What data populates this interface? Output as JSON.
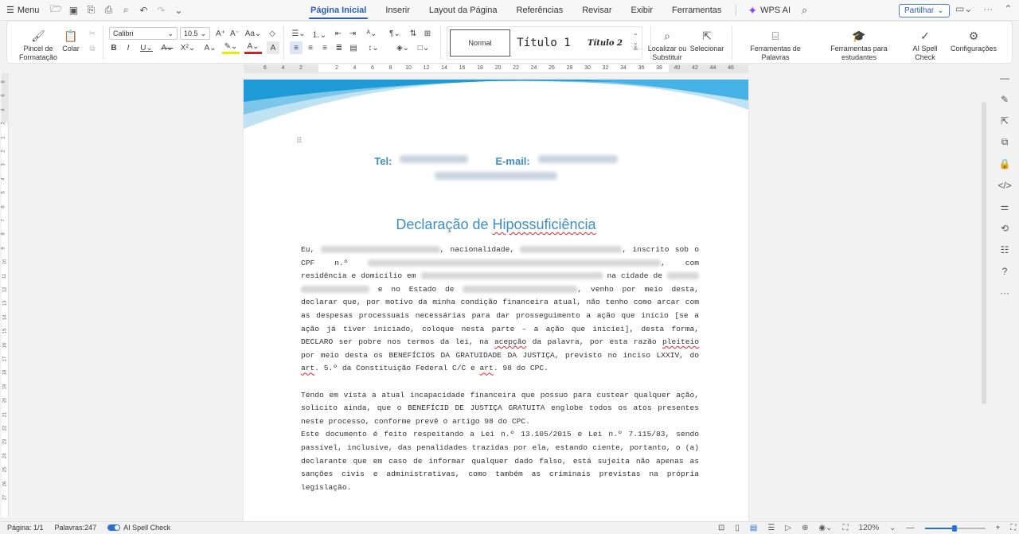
{
  "topbar": {
    "menu_label": "Menu",
    "tabs": [
      "Página Inicial",
      "Inserir",
      "Layout da Página",
      "Referências",
      "Revisar",
      "Exibir",
      "Ferramentas"
    ],
    "wps_ai": "WPS AI",
    "share_label": "Partilhar"
  },
  "ribbon": {
    "format_painter": "Pincel de Formatação",
    "paste": "Colar",
    "font_name": "Calibri",
    "font_size": "10.5",
    "style_normal": "Normal",
    "style_title1": "Título 1",
    "style_title2": "Título 2",
    "find_replace": "Localizar ou Substituir",
    "select": "Selecionar",
    "word_tools": "Ferramentas de Palavras",
    "student_tools": "Ferramentas para estudantes",
    "ai_spell": "AI Spell Check",
    "settings": "Configurações"
  },
  "ruler": {
    "marks": [
      "6",
      "4",
      "2",
      "",
      "2",
      "4",
      "6",
      "8",
      "10",
      "12",
      "14",
      "16",
      "18",
      "20",
      "22",
      "24",
      "26",
      "28",
      "30",
      "32",
      "34",
      "36",
      "38",
      "40",
      "42",
      "44",
      "46"
    ]
  },
  "document": {
    "tel_label": "Tel:",
    "email_label": "E-mail:",
    "title_prefix": "Declaração de ",
    "title_word": "Hipossuficiência",
    "p1": {
      "a": "Eu, ",
      "b": ", nacionalidade, ",
      "c": ", inscrito sob o CPF n.º ",
      "d": ", com residência e domicílio em ",
      "e": " na cidade de ",
      "f": " e no Estado de ",
      "g": ", venho por meio desta, declarar que, por motivo da minha condição financeira atual, não tenho como arcar com as despesas processuais necessárias para dar prosseguimento a ação que início [se a ação já tiver iniciado, coloque nesta parte – a ação que iniciei], desta forma, DECLARO ser pobre nos termos da lei, na ",
      "h": "acepção",
      "i": " da palavra,  por esta razão ",
      "j": "pleiteio",
      "k": " por meio desta os BENEFÍCIOS DA GRATUIDADE DA JUSTIÇA, previsto no inciso LXXIV, do ",
      "l": "art",
      "m": ". 5.º da Constituição Federal C/C e ",
      "n": "art",
      "o": ". 98 do CPC."
    },
    "p2": "Tendo em vista a atual incapacidade financeira que possuo para custear qualquer ação, solicito ainda, que o BENEFÍCID DE JUSTIÇA GRATUITA englobe todos os atos presentes neste processo, conforme prevê o artigo 98 do CPC.",
    "p3": "Este documento é feito respeitando a Lei n.º 13.105/2015 e Lei n.º 7.115/83, sendo passível, inclusive, das penalidades trazidas por ela, estando ciente, portanto, o (a) declarante que em caso de informar qualquer dado falso, está sujeita não apenas as sanções civis e administrativas, como também as criminais previstas na própria legislação."
  },
  "status": {
    "page": "Página: 1/1",
    "words": "Palavras:247",
    "ai_spell": "AI Spell Check",
    "zoom": "120%"
  },
  "colors": {
    "accent": "#2b5eb6",
    "title": "#3d8ec4",
    "wave_dark": "#1e9ad6",
    "wave_light": "#bfe3f5",
    "ai_star": "#8a3ffc"
  }
}
